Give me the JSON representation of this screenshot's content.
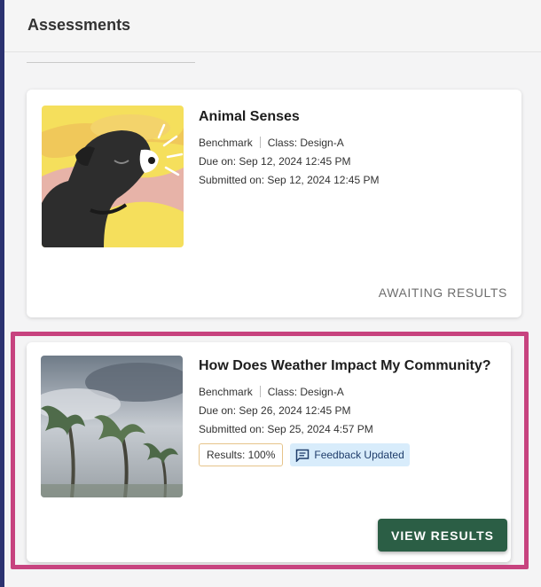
{
  "header": {
    "title": "Assessments"
  },
  "assessments": [
    {
      "title": "Animal Senses",
      "type": "Benchmark",
      "class": "Class: Design-A",
      "due": "Due on: Sep 12, 2024 12:45 PM",
      "submitted": "Submitted on: Sep 12, 2024 12:45 PM",
      "status": "AWAITING RESULTS"
    },
    {
      "title": "How Does Weather Impact My Community?",
      "type": "Benchmark",
      "class": "Class: Design-A",
      "due": "Due on: Sep 26, 2024 12:45 PM",
      "submitted": "Submitted on: Sep 25, 2024 4:57 PM",
      "results_label": "Results: 100%",
      "feedback_label": "Feedback Updated",
      "action_label": "VIEW RESULTS"
    }
  ],
  "colors": {
    "accent_button": "#2b5e45",
    "highlight": "#c7437f",
    "sidebar": "#2b3270"
  }
}
